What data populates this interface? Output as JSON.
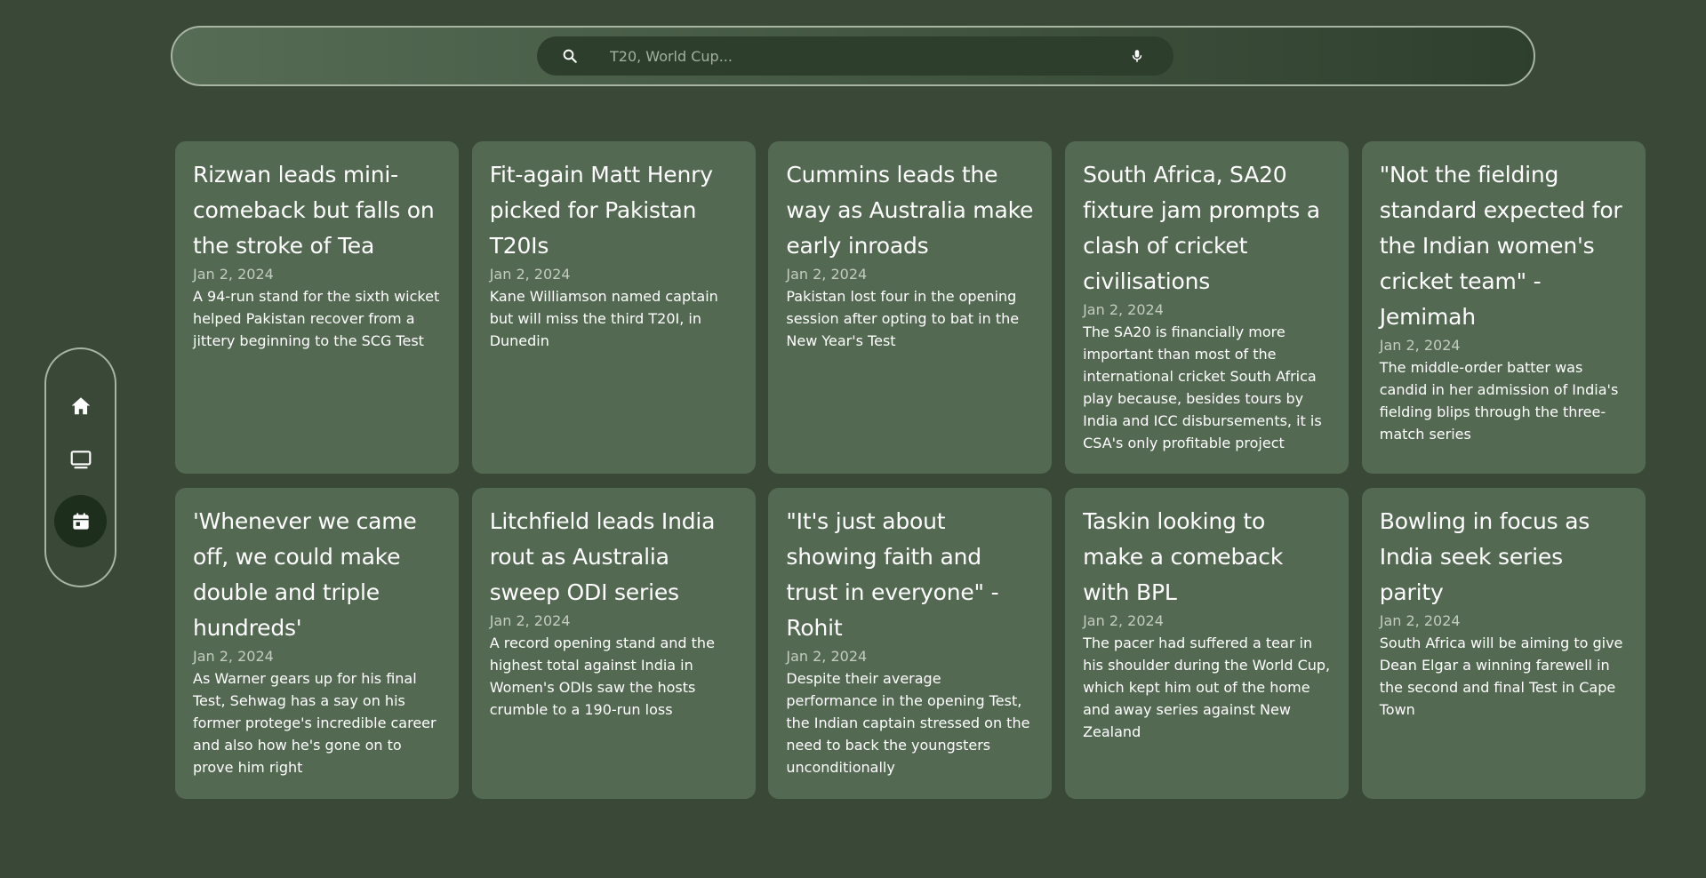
{
  "search": {
    "placeholder": "T20, World Cup..."
  },
  "nav": {
    "items": [
      {
        "icon": "home-icon",
        "active": false
      },
      {
        "icon": "tv-icon",
        "active": false
      },
      {
        "icon": "calendar-icon",
        "active": true
      }
    ]
  },
  "colors": {
    "background": "#3a4837",
    "card": "#536952",
    "active_nav": "#1e2e1d",
    "border": "#a8b5a3"
  },
  "articles": [
    {
      "title": "Rizwan leads mini-comeback but falls on the stroke of Tea",
      "date": "Jan 2, 2024",
      "summary": "A 94-run stand for the sixth wicket helped Pakistan recover from a jittery beginning to the SCG Test"
    },
    {
      "title": "Fit-again Matt Henry picked for Pakistan T20Is",
      "date": "Jan 2, 2024",
      "summary": "Kane Williamson named captain but will miss the third T20I, in Dunedin"
    },
    {
      "title": "Cummins leads the way as Australia make early inroads",
      "date": "Jan 2, 2024",
      "summary": "Pakistan lost four in the opening session after opting to bat in the New Year's Test"
    },
    {
      "title": "South Africa, SA20 fixture jam prompts a clash of cricket civilisations",
      "date": "Jan 2, 2024",
      "summary": "The SA20 is financially more important than most of the international cricket South Africa play because, besides tours by India and ICC disbursements, it is CSA's only profitable project"
    },
    {
      "title": "\"Not the fielding standard expected for the Indian women's cricket team\" - Jemimah",
      "date": "Jan 2, 2024",
      "summary": "The middle-order batter was candid in her admission of India's fielding blips through the three-match series"
    },
    {
      "title": "'Whenever we came off, we could make double and triple hundreds'",
      "date": "Jan 2, 2024",
      "summary": "As Warner gears up for his final Test, Sehwag has a say on his former protege's incredible career and also how he's gone on to prove him right"
    },
    {
      "title": "Litchfield leads India rout as Australia sweep ODI series",
      "date": "Jan 2, 2024",
      "summary": "A record opening stand and the highest total against India in Women's ODIs saw the hosts crumble to a 190-run loss"
    },
    {
      "title": "\"It's just about showing faith and trust in everyone\" - Rohit",
      "date": "Jan 2, 2024",
      "summary": "Despite their average performance in the opening Test, the Indian captain stressed on the need to back the youngsters unconditionally"
    },
    {
      "title": "Taskin looking to make a comeback with BPL",
      "date": "Jan 2, 2024",
      "summary": "The pacer had suffered a tear in his shoulder during the World Cup, which kept him out of the home and away series against New Zealand"
    },
    {
      "title": "Bowling in focus as India seek series parity",
      "date": "Jan 2, 2024",
      "summary": "South Africa will be aiming to give Dean Elgar a winning farewell in the second and final Test in Cape Town"
    }
  ]
}
